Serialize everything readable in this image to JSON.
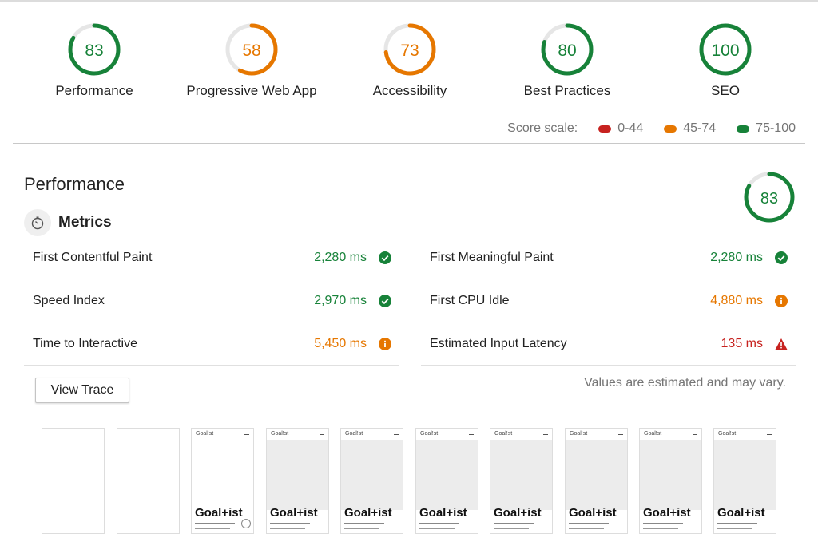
{
  "colors": {
    "pass": "#178239",
    "average": "#e67700",
    "fail": "#c7221f",
    "pass_ring": "#0cce6b",
    "track": "#e6e6e6"
  },
  "categories": [
    {
      "score": 83,
      "label": "Performance",
      "status": "pass"
    },
    {
      "score": 58,
      "label": "Progressive Web App",
      "status": "average"
    },
    {
      "score": 73,
      "label": "Accessibility",
      "status": "average"
    },
    {
      "score": 80,
      "label": "Best Practices",
      "status": "pass"
    },
    {
      "score": 100,
      "label": "SEO",
      "status": "pass"
    }
  ],
  "score_scale": {
    "label": "Score scale:",
    "ranges": [
      {
        "text": "0-44",
        "color": "#c7221f"
      },
      {
        "text": "45-74",
        "color": "#e67700"
      },
      {
        "text": "75-100",
        "color": "#178239"
      }
    ]
  },
  "performance": {
    "title": "Performance",
    "score": 83,
    "metrics_title": "Metrics",
    "metrics": [
      {
        "label": "First Contentful Paint",
        "value": "2,280 ms",
        "status": "pass",
        "icon": "check-circle-icon"
      },
      {
        "label": "First Meaningful Paint",
        "value": "2,280 ms",
        "status": "pass",
        "icon": "check-circle-icon"
      },
      {
        "label": "Speed Index",
        "value": "2,970 ms",
        "status": "pass",
        "icon": "check-circle-icon"
      },
      {
        "label": "First CPU Idle",
        "value": "4,880 ms",
        "status": "average",
        "icon": "info-circle-icon"
      },
      {
        "label": "Time to Interactive",
        "value": "5,450 ms",
        "status": "average",
        "icon": "info-circle-icon"
      },
      {
        "label": "Estimated Input Latency",
        "value": "135 ms",
        "status": "fail",
        "icon": "warning-triangle-icon"
      }
    ],
    "view_trace_label": "View Trace",
    "estimate_note": "Values are estimated and may vary."
  },
  "filmstrip": {
    "brand": "Goal!st",
    "title": "Goal+ist"
  }
}
